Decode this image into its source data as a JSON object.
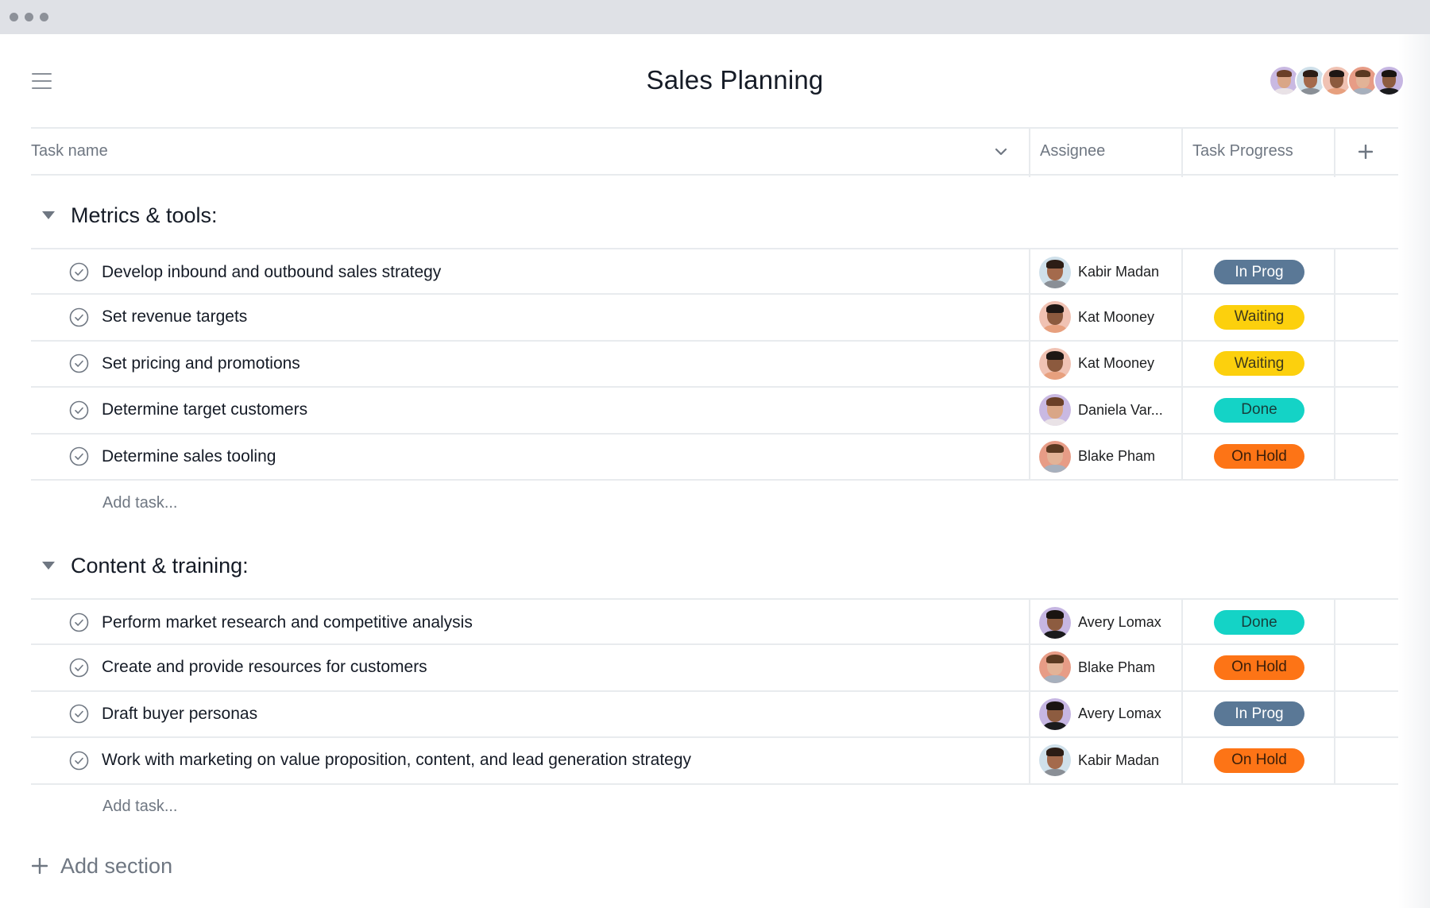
{
  "window": {
    "controls": [
      "close",
      "minimize",
      "maximize"
    ]
  },
  "header": {
    "menu_icon": "hamburger-menu-icon",
    "title": "Sales Planning",
    "members": [
      {
        "name": "Daniela Vargas",
        "bg": "#c9b9e2",
        "skin": "#d9a687",
        "hair": "#6a4028",
        "shirt": "#e9e2e6"
      },
      {
        "name": "Kabir Madan",
        "bg": "#cfe0ea",
        "skin": "#a46a4c",
        "hair": "#2c1d15",
        "shirt": "#8a8f96"
      },
      {
        "name": "Kat Mooney",
        "bg": "#f0c2b3",
        "skin": "#8c5a3e",
        "hair": "#1e1714",
        "shirt": "#e7a07e"
      },
      {
        "name": "Blake Pham",
        "bg": "#e79c86",
        "skin": "#e2b397",
        "hair": "#5b3a22",
        "shirt": "#a7b0bd"
      },
      {
        "name": "Avery Lomax",
        "bg": "#c6b6e2",
        "skin": "#8d5c40",
        "hair": "#1a1411",
        "shirt": "#1b1b1d"
      }
    ]
  },
  "columns": {
    "task_name": "Task name",
    "assignee": "Assignee",
    "task_progress": "Task Progress",
    "add_column_icon": "plus-icon",
    "sort_icon": "chevron-down-icon"
  },
  "status_colors": {
    "In Prog": {
      "bg": "#5a7896",
      "fg": "#ffffff"
    },
    "Waiting": {
      "bg": "#fcd00d",
      "fg": "#3f3a1c"
    },
    "Done": {
      "bg": "#14d3c6",
      "fg": "#17403d"
    },
    "On Hold": {
      "bg": "#fd7416",
      "fg": "#3a1e0a"
    }
  },
  "avatars": {
    "Kabir Madan": {
      "bg": "#cfe0ea",
      "skin": "#a46a4c",
      "hair": "#2c1d15",
      "shirt": "#8a8f96"
    },
    "Kat Mooney": {
      "bg": "#f0c2b3",
      "skin": "#8c5a3e",
      "hair": "#1e1714",
      "shirt": "#e7a07e"
    },
    "Daniela Var...": {
      "bg": "#c9b9e2",
      "skin": "#d9a687",
      "hair": "#6a4028",
      "shirt": "#e9e2e6"
    },
    "Blake Pham": {
      "bg": "#e79c86",
      "skin": "#e2b397",
      "hair": "#5b3a22",
      "shirt": "#a7b0bd"
    },
    "Avery Lomax": {
      "bg": "#c6b6e2",
      "skin": "#8d5c40",
      "hair": "#1a1411",
      "shirt": "#1b1b1d"
    }
  },
  "sections": [
    {
      "title": "Metrics & tools:",
      "tasks": [
        {
          "name": "Develop inbound and outbound sales strategy",
          "assignee": "Kabir Madan",
          "status": "In Prog"
        },
        {
          "name": "Set revenue targets",
          "assignee": "Kat Mooney",
          "status": "Waiting"
        },
        {
          "name": "Set pricing and promotions",
          "assignee": "Kat Mooney",
          "status": "Waiting"
        },
        {
          "name": "Determine target customers",
          "assignee": "Daniela Var...",
          "status": "Done"
        },
        {
          "name": "Determine sales tooling",
          "assignee": "Blake Pham",
          "status": "On Hold"
        }
      ],
      "add_task_placeholder": "Add task..."
    },
    {
      "title": "Content & training:",
      "tasks": [
        {
          "name": "Perform market research and competitive analysis",
          "assignee": "Avery Lomax",
          "status": "Done"
        },
        {
          "name": "Create and provide resources for customers",
          "assignee": "Blake Pham",
          "status": "On Hold"
        },
        {
          "name": "Draft buyer personas",
          "assignee": "Avery Lomax",
          "status": "In Prog"
        },
        {
          "name": "Work with marketing on value proposition, content, and lead generation strategy",
          "assignee": "Kabir Madan",
          "status": "On Hold"
        }
      ],
      "add_task_placeholder": "Add task..."
    }
  ],
  "footer": {
    "add_section_label": "Add section"
  }
}
